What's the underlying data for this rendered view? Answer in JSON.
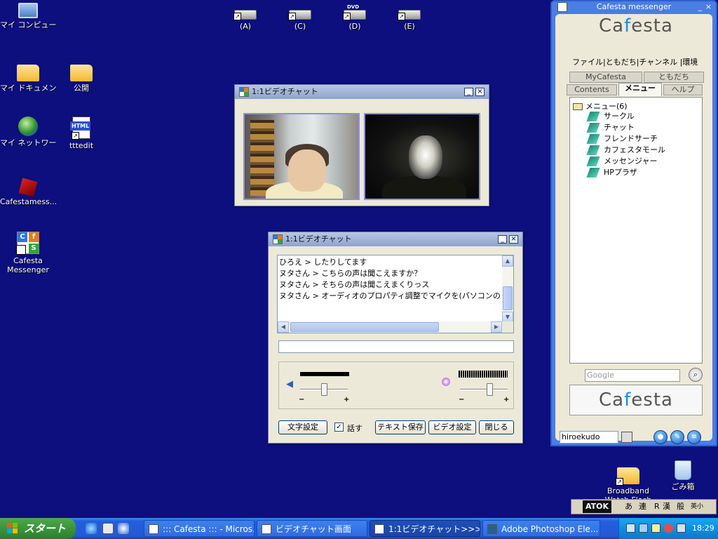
{
  "desktop": {
    "icons": [
      {
        "label": "マイ コンピュータ"
      },
      {
        "label": "マイ ドキュメント"
      },
      {
        "label": "公開"
      },
      {
        "label": "マイ ネットワーク"
      },
      {
        "label": "tttedit"
      },
      {
        "label": "Cafestamess..."
      },
      {
        "label": "Cafesta Messenger"
      },
      {
        "label": "(A)"
      },
      {
        "label": "(C)"
      },
      {
        "label": "(D)"
      },
      {
        "label": "(E)"
      },
      {
        "label": "Broadband Watch Flash"
      },
      {
        "label": "ごみ箱"
      }
    ],
    "dvd_badge": "DVD",
    "html_badge": "HTML",
    "cf_letters": [
      "C",
      "f",
      "S"
    ]
  },
  "video_window": {
    "title": "1:1ビデオチャット",
    "minimize": "_",
    "close": "×"
  },
  "chat_window": {
    "title": "1:1ビデオチャット",
    "minimize": "_",
    "close": "×",
    "messages": [
      "ひろえ > したりしてます",
      "ヌタさん > こちらの声は聞こえますか？",
      "ヌタさん > そちらの声は聞こえまくりっス",
      "ヌタさん > オーディオのプロパティ調整でマイクを(パソコンの)ミュートを"
    ],
    "input_value": "",
    "scroll_up": "▲",
    "scroll_down": "▼",
    "scroll_left": "◀",
    "scroll_right": "▶",
    "minus": "−",
    "plus": "+",
    "speaker_volume": 0.5,
    "mic_volume": 0.65,
    "buttons": {
      "font": "文字設定",
      "speak_label": "話す",
      "speak_checked": "✓",
      "save_text": "テキスト保存",
      "video_settings": "ビデオ設定",
      "close": "閉じる"
    }
  },
  "messenger": {
    "title": "Cafesta messenger",
    "logo_pre": "Ca",
    "logo_f": "f",
    "logo_post": "esta",
    "menu": "ファイル|ともだち|チャンネル |環境",
    "tabs": {
      "mycafesta": "MyCafesta",
      "friends": "ともだち",
      "contents": "Contents",
      "menu": "メニュー",
      "help": "ヘルプ"
    },
    "tree_root": "メニュー(6)",
    "tree_items": [
      "サークル",
      "チャット",
      "フレンドサーチ",
      "カフェスタモール",
      "メッセンジャー",
      "HPプラザ"
    ],
    "search_placeholder": "Google",
    "search_icon": "magnifier-icon",
    "username": "hiroekudo",
    "minimize": "_",
    "close": "×"
  },
  "atok": {
    "name": "ATOK",
    "modes": [
      "あ",
      "連",
      "R",
      "漢",
      "般",
      "英小"
    ]
  },
  "taskbar": {
    "start": "スタート",
    "tasks": [
      {
        "label": "::: Cafesta ::: - Micros..."
      },
      {
        "label": "ビデオチャット画面"
      },
      {
        "label": "1:1ビデオチャット>>>"
      },
      {
        "label": "Adobe Photoshop Ele..."
      }
    ],
    "clock": "18:29"
  }
}
